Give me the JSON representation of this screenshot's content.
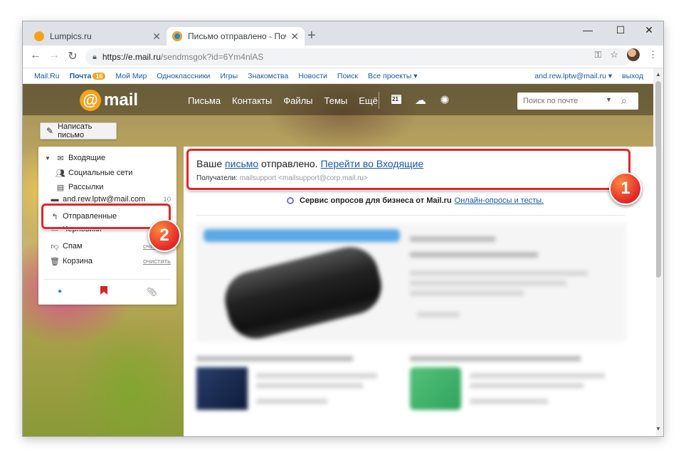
{
  "browser": {
    "tabs": [
      {
        "title": "Lumpics.ru",
        "favicon_color": "#f7a21b"
      },
      {
        "title": "Письмо отправлено - Почта Ма",
        "favicon_color": "#168de2"
      }
    ],
    "new_tab": "+",
    "controls": {
      "minimize": "—",
      "maximize": "☐",
      "close": "✕"
    },
    "url_host": "https://e.mail.ru",
    "url_path": "/sendmsgok?id=6Ym4nlAS"
  },
  "portal_nav": {
    "items": [
      "Mail.Ru",
      "Почта",
      "Мой Мир",
      "Одноклассники",
      "Игры",
      "Знакомства",
      "Новости",
      "Поиск",
      "Все проекты ▾"
    ],
    "mail_badge": "16",
    "user": "and.rew.lptw@mail.ru ▾",
    "logout": "выход"
  },
  "header": {
    "logo_at": "@",
    "logo_word": "mail",
    "nav": [
      "Письма",
      "Контакты",
      "Файлы",
      "Темы",
      "Ещё"
    ],
    "calendar_day": "21",
    "search_placeholder": "Поиск по почте"
  },
  "sidebar": {
    "compose": "Написать письмо",
    "folders": [
      {
        "label": "Входящие"
      },
      {
        "label": "Социальные сети"
      },
      {
        "label": "Рассылки"
      },
      {
        "label": "and.rew.lptw@mail.com"
      },
      {
        "label": "Отправленные"
      },
      {
        "label": "Черновики"
      },
      {
        "label": "Спам",
        "action": "очистить"
      },
      {
        "label": "Корзина",
        "action": "очистить"
      }
    ],
    "folder_count": "10"
  },
  "content": {
    "sent_prefix": "Ваше",
    "sent_link": "письмо",
    "sent_middle": "отправлено.",
    "goto_inbox": "Перейти во Входящие",
    "recipients_label": "Получатели:",
    "recipient": "mailsupport <mailsupport@corp.mail.ru>",
    "survey_bold": "Сервис опросов для бизнеса от Mail.ru",
    "survey_link": "Онлайн-опросы и тесты."
  },
  "annotations": {
    "one": "1",
    "two": "2"
  },
  "colors": {
    "accent": "#f7a21b",
    "link": "#1a5aa6",
    "highlight": "#e0272a"
  }
}
